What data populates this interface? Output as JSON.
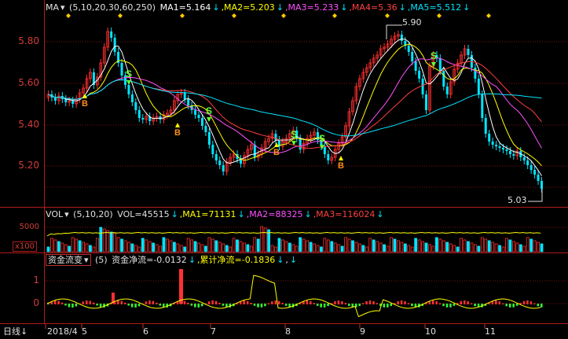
{
  "price_panel": {
    "ma_label": "MA",
    "ma_params": "(5,10,20,30,60,250)",
    "ma_items": [
      {
        "label": "MA1=5.164",
        "color": "#ffffff"
      },
      {
        "label": ",MA2=5.203",
        "color": "#ffff00"
      },
      {
        "label": ",MA3=5.233",
        "color": "#ff50ff"
      },
      {
        "label": ",MA4=5.36",
        "color": "#ff4040"
      },
      {
        "label": ",MA5=5.512",
        "color": "#00e5ff"
      }
    ],
    "y_ticks": [
      "5.80",
      "5.60",
      "5.40",
      "5.20"
    ],
    "high_label": "5.90",
    "low_label": "5.03",
    "buy_marker": "B",
    "sell_marker": "S"
  },
  "volume_panel": {
    "label": "VOL",
    "params": "(5,10,20)",
    "items": [
      {
        "label": "VOL=45515",
        "color": "#e0e0e0"
      },
      {
        "label": ",MA1=71131",
        "color": "#ffff00"
      },
      {
        "label": ",MA2=88325",
        "color": "#ff50ff"
      },
      {
        "label": ",MA3=116024",
        "color": "#ff4040"
      }
    ],
    "y_tick": "5000",
    "unit": "x100"
  },
  "fund_panel": {
    "indicator": "资金流变",
    "param": "(5)",
    "items": [
      {
        "label": "资金净流=-0.0132",
        "color": "#e0e0e0"
      },
      {
        "label": ",累计净流=-0.1836",
        "color": "#ffff00"
      },
      {
        "label": ",",
        "color": "#e0e0e0"
      }
    ],
    "y_ticks": [
      "1",
      "0"
    ]
  },
  "x_axis": {
    "period": "日线",
    "labels": [
      "2018/4",
      "5",
      "6",
      "7",
      "8",
      "9",
      "10",
      "11"
    ]
  },
  "colors": {
    "up": "#ff3030",
    "down": "#00e5ff",
    "grid": "#7a1414",
    "border": "#b01c1c"
  }
}
